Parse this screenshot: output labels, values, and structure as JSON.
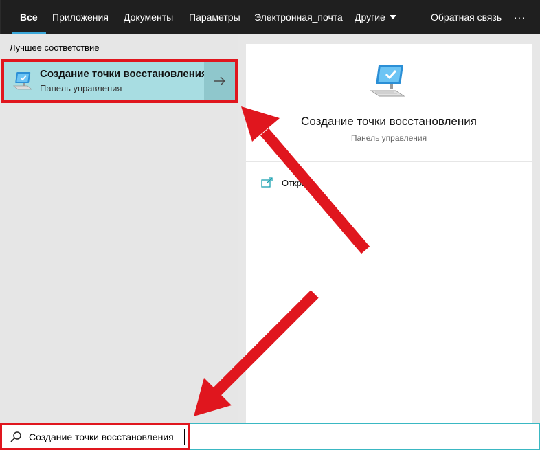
{
  "nav": {
    "tabs": [
      {
        "label": "Все",
        "active": true
      },
      {
        "label": "Приложения"
      },
      {
        "label": "Документы"
      },
      {
        "label": "Параметры"
      },
      {
        "label": "Электронная_почта"
      },
      {
        "label": "Другие"
      }
    ],
    "feedback": "Обратная связь",
    "more": "···"
  },
  "results": {
    "section_label": "Лучшее соответствие",
    "best_match": {
      "title": "Создание точки восстановления",
      "subtitle": "Панель управления",
      "icon": "monitor-check-icon"
    }
  },
  "detail": {
    "title": "Создание точки восстановления",
    "subtitle": "Панель управления",
    "icon": "monitor-check-icon",
    "actions": [
      {
        "label": "Открыть",
        "icon": "open-icon"
      }
    ]
  },
  "search": {
    "value": "Создание точки восстановления",
    "icon": "search-icon"
  },
  "colors": {
    "nav_bg": "#1f1f1f",
    "accent": "#3aa7d9",
    "highlight_bg": "#a8dde2",
    "annotation_red": "#e0161e"
  }
}
